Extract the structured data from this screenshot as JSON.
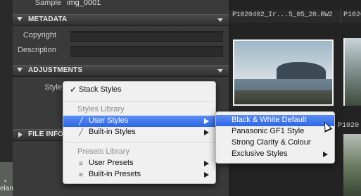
{
  "inspector": {
    "sample_label": "Sample",
    "sample_value": "img_0001",
    "metadata": {
      "title": "METADATA",
      "fields": [
        {
          "label": "Copyright",
          "value": ""
        },
        {
          "label": "Description",
          "value": ""
        }
      ]
    },
    "adjustments": {
      "title": "ADJUSTMENTS",
      "style_label": "Style"
    },
    "file_info": {
      "title": "FILE INFO"
    },
    "thumb_caption": "elan"
  },
  "browser": {
    "filename_1": "P1020402_Ir...5_05_20.RW2",
    "filename_2": "P1020",
    "filename_3": "P1020"
  },
  "style_menu": {
    "stack_styles": "Stack Styles",
    "styles_library_header": "Styles Library",
    "user_styles": "User Styles",
    "built_in_styles": "Built-in Styles",
    "presets_library_header": "Presets Library",
    "user_presets": "User Presets",
    "built_in_presets": "Built-in Presets"
  },
  "user_styles_submenu": {
    "items": [
      "Black & White Default",
      "Panasonic GF1 Style",
      "Strong Clarity & Colour",
      "Exclusive Styles"
    ]
  },
  "colors": {
    "highlight": "#2e66e6",
    "panel": "#3a3a3a"
  }
}
